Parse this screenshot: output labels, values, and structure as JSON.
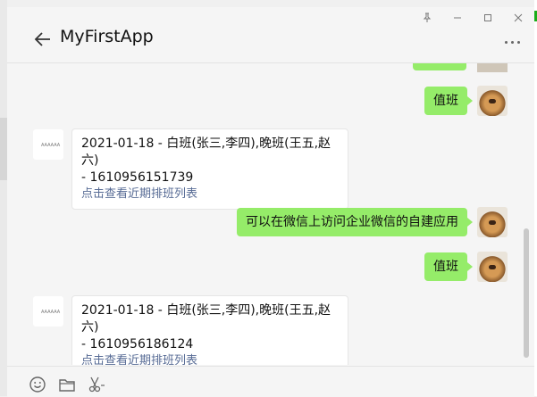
{
  "window": {
    "title": "MyFirstApp",
    "controls": {
      "pin": "⊥",
      "minimize": "–",
      "maximize": "□",
      "close": "✕"
    }
  },
  "bot_avatar_text": "AAAAAA",
  "messages": [
    {
      "side": "right",
      "text": "值班"
    },
    {
      "side": "left",
      "line1": "2021-01-18 - 白班(张三,李四),晚班(王五,赵六)",
      "line2": "- 1610956151739",
      "link": "点击查看近期排班列表"
    },
    {
      "side": "right",
      "text": "可以在微信上访问企业微信的自建应用"
    },
    {
      "side": "right",
      "text": "值班"
    },
    {
      "side": "left",
      "line1": "2021-01-18 - 白班(张三,李四),晚班(王五,赵六)",
      "line2": "- 1610956186124",
      "link": "点击查看近期排班列表"
    }
  ],
  "toolbar": [
    "emoji-icon",
    "folder-icon",
    "scissors-icon"
  ],
  "colors": {
    "green_bubble": "#95ec69",
    "link": "#576b95",
    "background": "#f5f5f5"
  }
}
